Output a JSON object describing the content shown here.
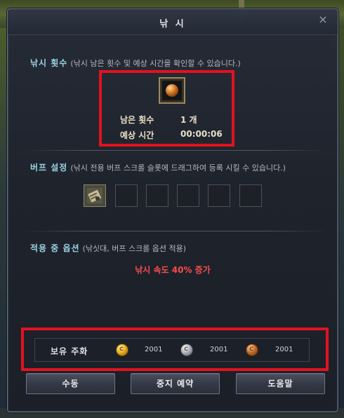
{
  "window": {
    "title": "낚 시",
    "close_glyph": "×"
  },
  "fishing_count": {
    "heading": "낚시 횟수",
    "description": "(낚시 남은 횟수 및 예상 시간을 확인할 수 있습니다.)",
    "item_icon": "orange-orb-icon",
    "remaining_label": "남은 횟수",
    "remaining_value": "1 개",
    "time_label": "예상 시간",
    "time_value": "00:00:06"
  },
  "buff_settings": {
    "heading": "버프 설정",
    "description": "(낚시 전용 버프 스크롤 슬롯에 드래그하여 등록 시킬 수 있습니다.)",
    "slots": [
      {
        "filled": true,
        "icon": "scroll-icon"
      },
      {
        "filled": false
      },
      {
        "filled": false
      },
      {
        "filled": false
      },
      {
        "filled": false
      },
      {
        "filled": false
      }
    ]
  },
  "applied_options": {
    "heading": "적용 중 옵션",
    "description": "(낚싯대, 버프 스크롤 옵션 적용)",
    "bonus_text": "낚시 속도 40% 증가"
  },
  "currency": {
    "label": "보유 주화",
    "coins": [
      {
        "type": "gold",
        "icon": "gold-coin-icon",
        "value": "2001"
      },
      {
        "type": "silver",
        "icon": "silver-coin-icon",
        "value": "2001"
      },
      {
        "type": "bronze",
        "icon": "bronze-coin-icon",
        "value": "2001"
      }
    ]
  },
  "buttons": {
    "manual": "수동",
    "stop_reserve": "중지 예약",
    "help": "도움말"
  },
  "colors": {
    "highlight_box": "#e3121e",
    "section_heading": "#9fd8e8",
    "bonus_text": "#ff4d4d",
    "panel_bg": "#1e232d"
  }
}
